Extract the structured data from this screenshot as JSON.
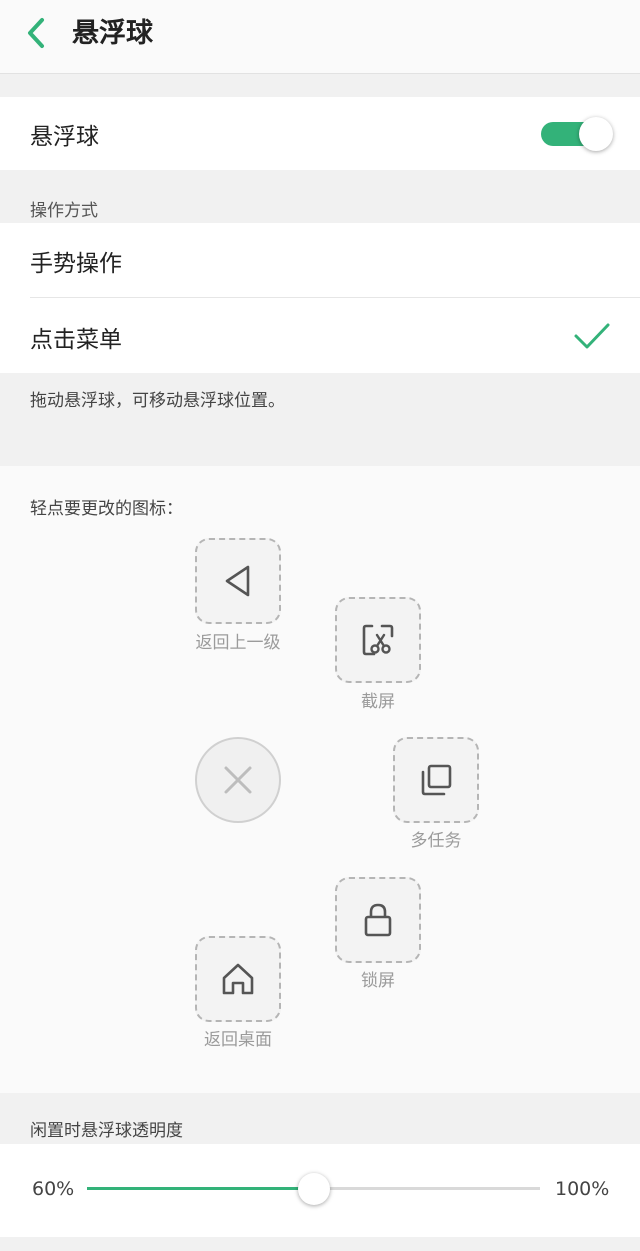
{
  "header": {
    "title": "悬浮球",
    "back_icon": "chevron-left-icon"
  },
  "floating_ball_toggle": {
    "label": "悬浮球",
    "on": true,
    "accent": "#33b279"
  },
  "operation": {
    "section_label": "操作方式",
    "options": [
      {
        "label": "手势操作",
        "selected": false
      },
      {
        "label": "点击菜单",
        "selected": true
      }
    ],
    "hint": "拖动悬浮球，可移动悬浮球位置。"
  },
  "icon_editor": {
    "label": "轻点要更改的图标：",
    "icons": [
      {
        "name": "back-icon",
        "label": "返回上一级"
      },
      {
        "name": "screenshot-icon",
        "label": "截屏"
      },
      {
        "name": "close-icon",
        "label": ""
      },
      {
        "name": "multitask-icon",
        "label": "多任务"
      },
      {
        "name": "lock-icon",
        "label": "锁屏"
      },
      {
        "name": "home-icon",
        "label": "返回桌面"
      }
    ]
  },
  "opacity": {
    "section_label": "闲置时悬浮球透明度",
    "min_label": "60%",
    "max_label": "100%",
    "value_fraction": 0.5
  }
}
